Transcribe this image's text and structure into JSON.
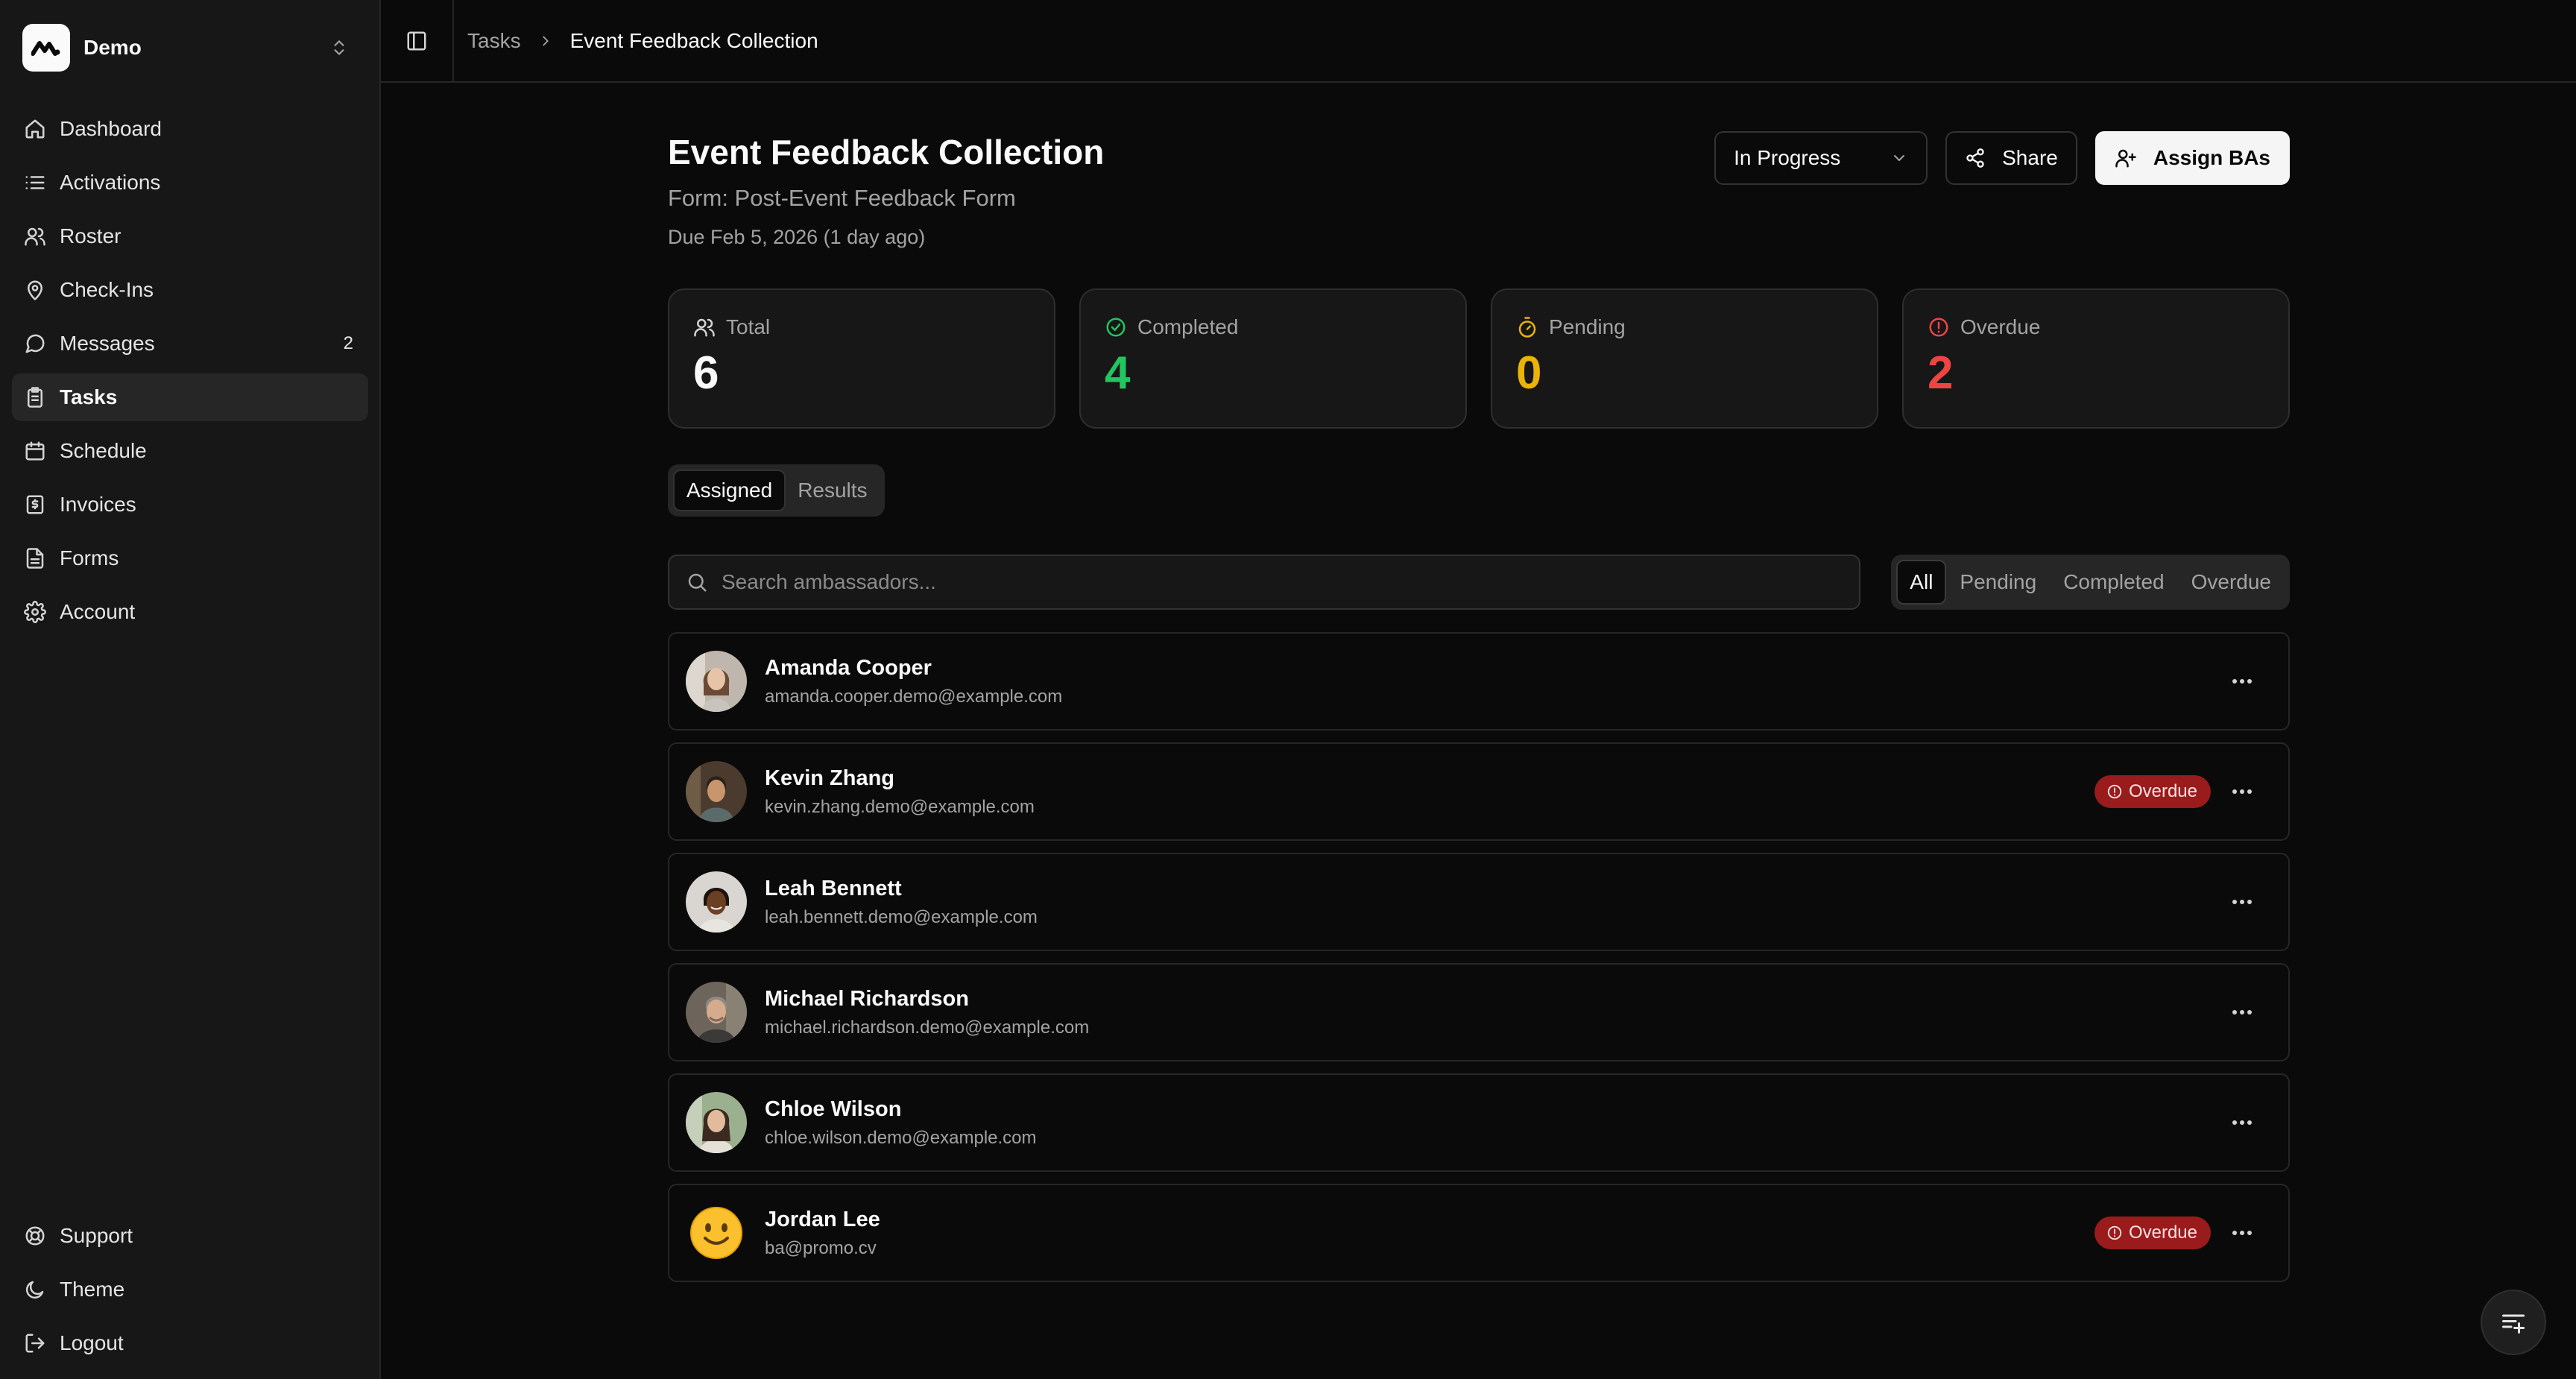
{
  "workspace": {
    "name": "Demo"
  },
  "sidebar": {
    "items": [
      {
        "label": "Dashboard",
        "icon": "home-icon"
      },
      {
        "label": "Activations",
        "icon": "list-icon"
      },
      {
        "label": "Roster",
        "icon": "users-icon"
      },
      {
        "label": "Check-Ins",
        "icon": "map-pin-icon"
      },
      {
        "label": "Messages",
        "icon": "message-circle-icon",
        "badge": "2"
      },
      {
        "label": "Tasks",
        "icon": "clipboard-icon",
        "active": true
      },
      {
        "label": "Schedule",
        "icon": "calendar-icon"
      },
      {
        "label": "Invoices",
        "icon": "receipt-icon"
      },
      {
        "label": "Forms",
        "icon": "file-text-icon"
      },
      {
        "label": "Account",
        "icon": "settings-icon"
      }
    ],
    "bottom": [
      {
        "label": "Support",
        "icon": "life-buoy-icon"
      },
      {
        "label": "Theme",
        "icon": "moon-icon"
      },
      {
        "label": "Logout",
        "icon": "logout-icon"
      }
    ]
  },
  "breadcrumb": {
    "parent": "Tasks",
    "current": "Event Feedback Collection"
  },
  "task": {
    "title": "Event Feedback Collection",
    "form": "Form: Post-Event Feedback Form",
    "due": "Due Feb 5, 2026 (1 day ago)"
  },
  "actions": {
    "status": "In Progress",
    "share": "Share",
    "assign": "Assign BAs"
  },
  "stats": [
    {
      "label": "Total",
      "value": "6",
      "color": "#fafafa",
      "icon": "users-icon"
    },
    {
      "label": "Completed",
      "value": "4",
      "color": "#22c55e",
      "icon": "check-circle-icon"
    },
    {
      "label": "Pending",
      "value": "0",
      "color": "#eab308",
      "icon": "timer-icon"
    },
    {
      "label": "Overdue",
      "value": "2",
      "color": "#ef4444",
      "icon": "alert-circle-icon"
    }
  ],
  "tabs": {
    "assigned": "Assigned",
    "results": "Results"
  },
  "search": {
    "placeholder": "Search ambassadors..."
  },
  "filters": {
    "all": "All",
    "pending": "Pending",
    "completed": "Completed",
    "overdue": "Overdue"
  },
  "ambassadors": [
    {
      "name": "Amanda Cooper",
      "email": "amanda.cooper.demo@example.com"
    },
    {
      "name": "Kevin Zhang",
      "email": "kevin.zhang.demo@example.com",
      "status": "Overdue"
    },
    {
      "name": "Leah Bennett",
      "email": "leah.bennett.demo@example.com"
    },
    {
      "name": "Michael Richardson",
      "email": "michael.richardson.demo@example.com"
    },
    {
      "name": "Chloe Wilson",
      "email": "chloe.wilson.demo@example.com"
    },
    {
      "name": "Jordan Lee",
      "email": "ba@promo.cv",
      "status": "Overdue"
    }
  ]
}
